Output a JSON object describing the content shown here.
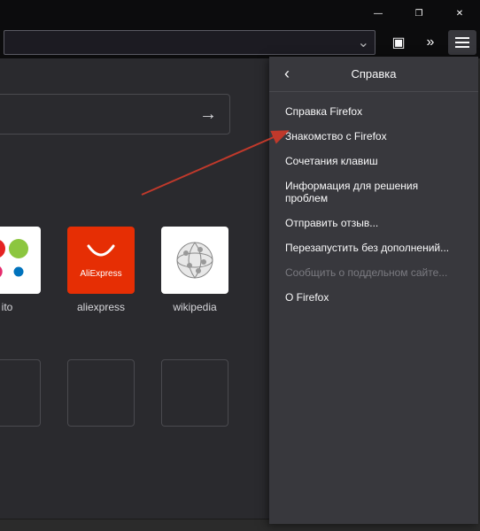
{
  "window": {
    "minimize_glyph": "—",
    "maximize_glyph": "❐",
    "close_glyph": "✕"
  },
  "toolbar": {
    "urlbar_dropdown": "⌄",
    "overflow": "»",
    "menu": "☰",
    "page_action": "▣"
  },
  "search": {
    "arrow": "→"
  },
  "tiles": [
    {
      "id": "avito",
      "label": "ito"
    },
    {
      "id": "aliexpress",
      "label": "aliexpress",
      "text": "AliExpress"
    },
    {
      "id": "wikipedia",
      "label": "wikipedia"
    }
  ],
  "menu": {
    "back_glyph": "‹",
    "title": "Справка",
    "items": [
      {
        "label": "Справка Firefox",
        "disabled": false
      },
      {
        "label": "Знакомство с Firefox",
        "disabled": false
      },
      {
        "label": "Сочетания клавиш",
        "disabled": false
      },
      {
        "label": "Информация для решения проблем",
        "disabled": false
      },
      {
        "label": "Отправить отзыв...",
        "disabled": false
      },
      {
        "label": "Перезапустить без дополнений...",
        "disabled": false
      },
      {
        "label": "Сообщить о поддельном сайте...",
        "disabled": true
      },
      {
        "label": "О Firefox",
        "disabled": false
      }
    ]
  },
  "colors": {
    "avito_1": "#e52322",
    "avito_2": "#8cc63f",
    "avito_3": "#e52b6c",
    "avito_4": "#0072bc",
    "aliexpress": "#e62e04",
    "arrow": "#c0392b"
  }
}
